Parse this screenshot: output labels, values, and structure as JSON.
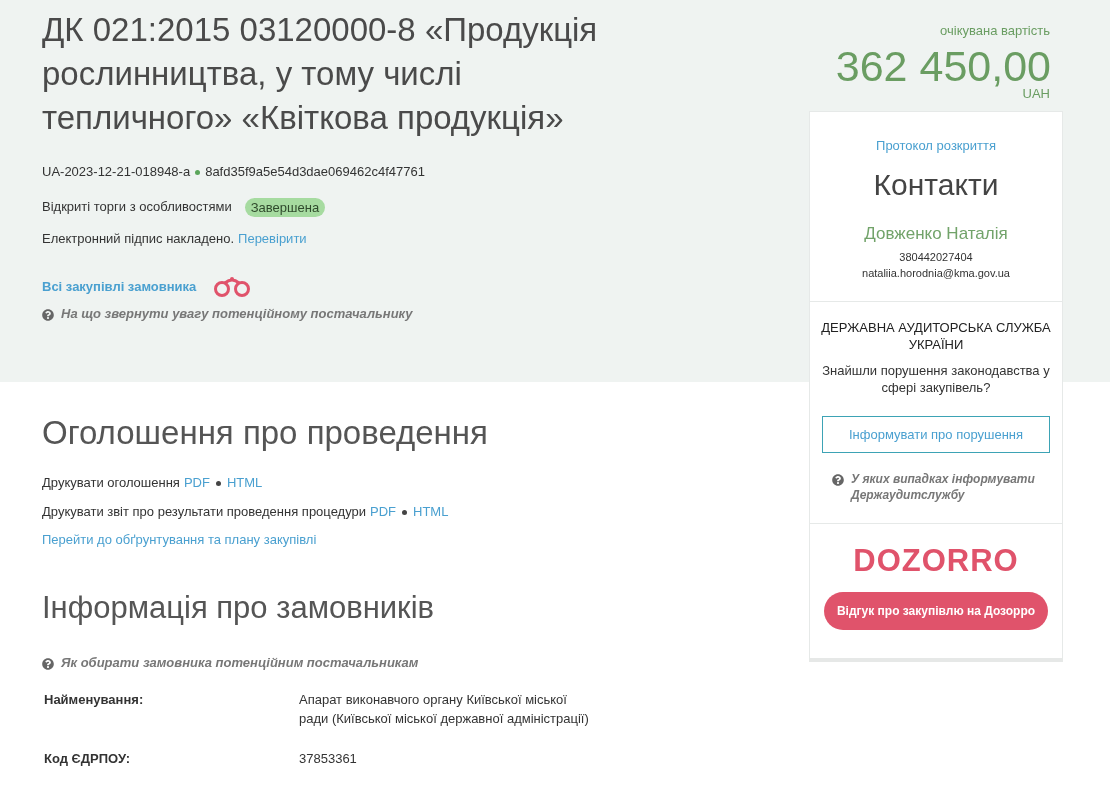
{
  "header": {
    "title": "ДК 021:2015 03120000-8 «Продукція рослинництва, у тому числі тепличного» «Квіткова продукція»",
    "tender_id": "UA-2023-12-21-018948-a",
    "hash": "8afd35f9a5e54d3dae069462c4f47761",
    "procedure": "Відкриті торги з особливостями",
    "status": "Завершена",
    "signature_text": "Електронний підпис накладено.",
    "signature_link": "Перевірити",
    "customer_link": "Всі закупівлі замовника",
    "hint": "На що звернути увагу потенційному постачальнику"
  },
  "expected_value": {
    "label": "очікувана вартість",
    "amount": "362 450,00",
    "currency": "UAH"
  },
  "contacts_card": {
    "protocol_link": "Протокол розкриття",
    "heading": "Контакти",
    "person": "Довженко Наталія",
    "phone": "380442027404",
    "email": "nataliia.horodnia@kma.gov.ua"
  },
  "audit_card": {
    "title": "ДЕРЖАВНА АУДИТОРСЬКА СЛУЖБА УКРАЇНИ",
    "question": "Знайшли порушення законодавства у сфері закупівель?",
    "button": "Інформувати про порушення",
    "hint": "У яких випадках інформувати Держаудитслужбу"
  },
  "dozorro_card": {
    "logo": "DOZORRO",
    "button": "Відгук про закупівлю на Дозорро"
  },
  "announcement": {
    "heading": "Оголошення про проведення",
    "print_lines": [
      {
        "text": "Друкувати оголошення",
        "links": [
          "PDF",
          "HTML"
        ]
      },
      {
        "text": "Друкувати звіт про результати проведення процедури",
        "links": [
          "PDF",
          "HTML"
        ]
      }
    ],
    "plan_link": "Перейти до обґрунтування та плану закупівлі"
  },
  "customers": {
    "heading": "Інформація про замовників",
    "hint": "Як обирати замовника потенційним постачальникам",
    "fields": [
      {
        "label": "Найменування:",
        "value": "Апарат виконавчого органу Київської міської ради (Київської міської державної адміністрації)"
      },
      {
        "label": "Код ЄДРПОУ:",
        "value": "37853361"
      }
    ]
  }
}
